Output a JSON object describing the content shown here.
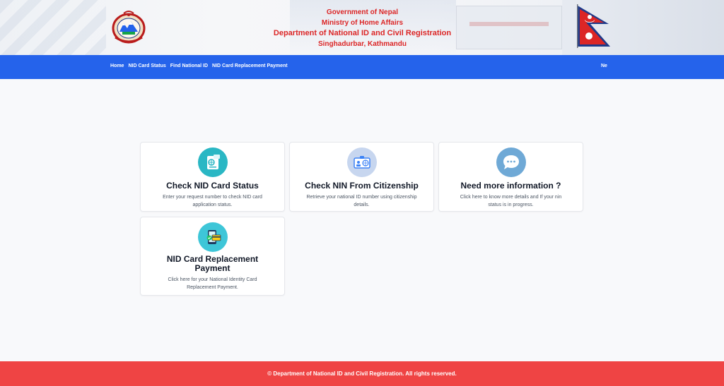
{
  "header": {
    "line1": "Government of Nepal",
    "line2": "Ministry of Home Affairs",
    "line3": "Department of National ID and Civil Registration",
    "line4": "Singhadurbar, Kathmandu",
    "emblem_icon": "nepal-emblem-icon",
    "flag_icon": "nepal-flag-icon"
  },
  "nav": {
    "links": [
      "Home",
      "NID Card Status",
      "Find National ID",
      "NID Card Replacement Payment"
    ],
    "language": "Ne"
  },
  "cards": [
    {
      "title": "Check NID Card Status",
      "description": "Enter your request number to check NID card application status.",
      "icon": "id-card-icon",
      "color": "#2ab7c4"
    },
    {
      "title": "Check NIN From Citizenship",
      "description": "Retrieve your national ID number using citizenship details.",
      "icon": "citizenship-card-icon",
      "color": "#c7d6ef"
    },
    {
      "title": "Need more information ?",
      "description": "Click here to know more details and If your nin status is in progress.",
      "icon": "chat-bubble-icon",
      "color": "#6fa9d6"
    },
    {
      "title": "NID Card Replacement Payment",
      "description": "Click here for your National Identity Card Replacement Payment.",
      "icon": "payment-card-icon",
      "color": "#3ec6d8"
    }
  ],
  "footer": {
    "text": "© Department of National ID and Civil Registration. All rights reserved."
  },
  "colors": {
    "nav": "#2563eb",
    "header_text": "#dc2626",
    "footer": "#ef4444"
  }
}
